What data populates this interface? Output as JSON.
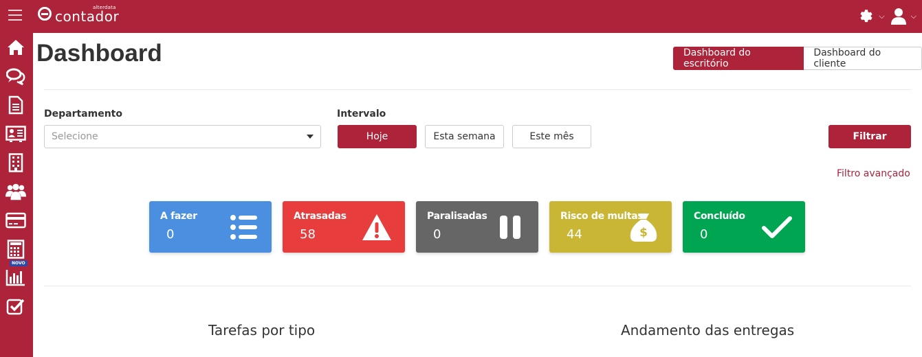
{
  "header": {
    "brand_small": "alterdata",
    "brand_name": "contador"
  },
  "sidebar": {
    "items": [
      {
        "name": "home-icon"
      },
      {
        "name": "chat-icon"
      },
      {
        "name": "document-icon"
      },
      {
        "name": "id-card-icon"
      },
      {
        "name": "building-icon"
      },
      {
        "name": "users-icon"
      },
      {
        "name": "credit-card-icon"
      },
      {
        "name": "calculator-icon"
      },
      {
        "name": "bar-chart-icon"
      },
      {
        "name": "checkbox-icon"
      }
    ],
    "new_badge": "NOVO"
  },
  "page": {
    "title": "Dashboard",
    "view_toggle": {
      "office": "Dashboard do escritório",
      "client": "Dashboard do cliente"
    }
  },
  "filters": {
    "department_label": "Departamento",
    "department_placeholder": "Selecione",
    "interval_label": "Intervalo",
    "interval_today": "Hoje",
    "interval_week": "Esta semana",
    "interval_month": "Este mês",
    "filter_button": "Filtrar",
    "advanced_link": "Filtro avançado"
  },
  "cards": [
    {
      "title": "A fazer",
      "value": "0",
      "color": "#4a8fe0",
      "icon": "list-icon"
    },
    {
      "title": "Atrasadas",
      "value": "58",
      "color": "#e83d3d",
      "icon": "warning-icon"
    },
    {
      "title": "Paralisadas",
      "value": "0",
      "color": "#666666",
      "icon": "pause-icon"
    },
    {
      "title": "Risco de multas",
      "value": "44",
      "color": "#c8b634",
      "icon": "money-bag-icon"
    },
    {
      "title": "Concluído",
      "value": "0",
      "color": "#00a551",
      "icon": "check-icon"
    }
  ],
  "sections": {
    "tasks_by_type": "Tarefas por tipo",
    "delivery_progress": "Andamento das entregas"
  },
  "colors": {
    "brand": "#ad2339"
  }
}
